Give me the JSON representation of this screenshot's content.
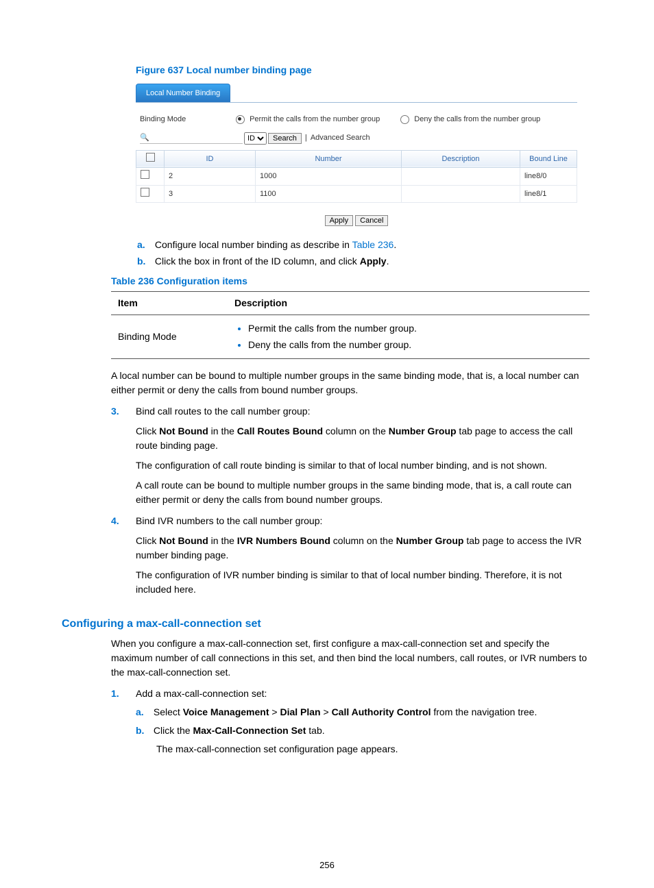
{
  "figure": {
    "title": "Figure 637 Local number binding page",
    "tab": "Local Number Binding",
    "binding_mode_label": "Binding Mode",
    "radio_permit": "Permit the calls from the number group",
    "radio_deny": "Deny the calls from the number group",
    "search_type_options": [
      "ID"
    ],
    "search_type_selected": "ID",
    "search_button": "Search",
    "advanced_search": "Advanced Search",
    "columns": {
      "id": "ID",
      "number": "Number",
      "description": "Description",
      "bound_line": "Bound Line"
    },
    "rows": [
      {
        "id": "2",
        "number": "1000",
        "description": "",
        "bound_line": "line8/0"
      },
      {
        "id": "3",
        "number": "1100",
        "description": "",
        "bound_line": "line8/1"
      }
    ],
    "apply": "Apply",
    "cancel": "Cancel"
  },
  "alpha_list": {
    "a_prefix": "Configure local number binding as describe in ",
    "a_link": "Table 236",
    "a_suffix": ".",
    "b_prefix": "Click the box in front of the ID column, and click ",
    "b_bold": "Apply",
    "b_suffix": "."
  },
  "cfg_table": {
    "title": "Table 236 Configuration items",
    "head_item": "Item",
    "head_desc": "Description",
    "row_item": "Binding Mode",
    "row_desc_bullets": [
      "Permit the calls from the number group.",
      "Deny the calls from the number group."
    ]
  },
  "body_para1": "A local number can be bound to multiple number groups in the same binding mode, that is, a local number can either permit or deny the calls from bound number groups.",
  "step3": {
    "label": "Bind call routes to the call number group:",
    "p1_parts": [
      "Click ",
      "Not Bound",
      " in the ",
      "Call Routes Bound",
      " column on the ",
      "Number Group",
      " tab page to access the call route binding page."
    ],
    "p2": "The configuration of call route binding is similar to that of local number binding, and is not shown.",
    "p3": "A call route can be bound to multiple number groups in the same binding mode, that is, a call route can either permit or deny the calls from bound number groups."
  },
  "step4": {
    "label": "Bind IVR numbers to the call number group:",
    "p1_parts": [
      "Click ",
      "Not Bound",
      " in the ",
      "IVR Numbers Bound",
      " column on the ",
      "Number Group",
      " tab page to access the IVR number binding page."
    ],
    "p2": "The configuration of IVR number binding is similar to that of local number binding. Therefore, it is not included here."
  },
  "section_heading": "Configuring a max-call-connection set",
  "section_intro": "When you configure a max-call-connection set, first configure a max-call-connection set and specify the maximum number of call connections in this set, and then bind the local numbers, call routes, or IVR numbers to the max-call-connection set.",
  "step1": {
    "label": "Add a max-call-connection set:",
    "a_parts": [
      "Select ",
      "Voice Management",
      " > ",
      "Dial Plan",
      " > ",
      "Call Authority Control",
      " from the navigation tree."
    ],
    "b_parts": [
      "Click the ",
      "Max-Call-Connection Set",
      " tab."
    ],
    "b_follow": "The max-call-connection set configuration page appears."
  },
  "page_number": "256"
}
